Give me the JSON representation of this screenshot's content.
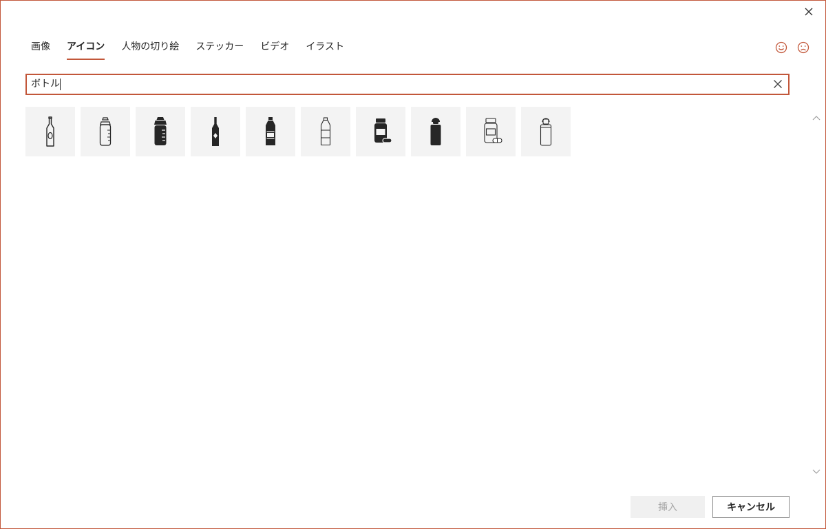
{
  "dialog": {
    "close_icon": "close-icon"
  },
  "tabs": [
    {
      "label": "画像",
      "active": false
    },
    {
      "label": "アイコン",
      "active": true
    },
    {
      "label": "人物の切り絵",
      "active": false
    },
    {
      "label": "ステッカー",
      "active": false
    },
    {
      "label": "ビデオ",
      "active": false
    },
    {
      "label": "イラスト",
      "active": false
    }
  ],
  "feedback": {
    "like_icon": "smiley-face-icon",
    "dislike_icon": "frowning-face-icon"
  },
  "search": {
    "value": "ボトル",
    "clear_icon": "clear-icon"
  },
  "results": [
    {
      "icon": "glass-bottle-label-icon"
    },
    {
      "icon": "baby-bottle-icon"
    },
    {
      "icon": "baby-bottle-filled-icon"
    },
    {
      "icon": "wine-bottle-icon"
    },
    {
      "icon": "water-bottle-filled-icon"
    },
    {
      "icon": "water-bottle-icon"
    },
    {
      "icon": "medicine-bottle-filled-icon"
    },
    {
      "icon": "sports-bottle-filled-icon"
    },
    {
      "icon": "medicine-bottle-icon"
    },
    {
      "icon": "sports-bottle-icon"
    }
  ],
  "footer": {
    "insert_label": "挿入",
    "cancel_label": "キャンセル"
  },
  "colors": {
    "accent": "#c2573a",
    "tile_bg": "#f3f3f3",
    "icon": "#262626"
  }
}
